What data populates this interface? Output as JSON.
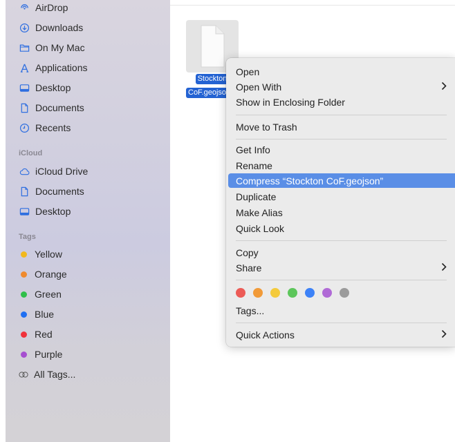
{
  "sidebar": {
    "favorites": [
      {
        "label": "AirDrop",
        "icon": "airdrop-icon"
      },
      {
        "label": "Downloads",
        "icon": "downloads-icon"
      },
      {
        "label": "On My Mac",
        "icon": "folder-icon"
      },
      {
        "label": "Applications",
        "icon": "applications-icon"
      },
      {
        "label": "Desktop",
        "icon": "desktop-icon"
      },
      {
        "label": "Documents",
        "icon": "document-icon"
      },
      {
        "label": "Recents",
        "icon": "clock-icon"
      }
    ],
    "icloud_header": "iCloud",
    "icloud": [
      {
        "label": "iCloud Drive",
        "icon": "cloud-icon"
      },
      {
        "label": "Documents",
        "icon": "document-icon"
      },
      {
        "label": "Desktop",
        "icon": "desktop-icon"
      }
    ],
    "tags_header": "Tags",
    "tags": [
      {
        "label": "Yellow",
        "color": "#f2b81d"
      },
      {
        "label": "Orange",
        "color": "#ef8a2e"
      },
      {
        "label": "Green",
        "color": "#2fbf4a"
      },
      {
        "label": "Blue",
        "color": "#1f6ff2"
      },
      {
        "label": "Red",
        "color": "#f0323a"
      },
      {
        "label": "Purple",
        "color": "#a64fd0"
      }
    ],
    "all_tags": "All Tags...",
    "accent_color": "#2f6fe0"
  },
  "file": {
    "name_line1": "Stockton",
    "name_line2": "CoF.geojson"
  },
  "context_menu": {
    "open": "Open",
    "open_with": "Open With",
    "show_enclosing": "Show in Enclosing Folder",
    "move_to_trash": "Move to Trash",
    "get_info": "Get Info",
    "rename": "Rename",
    "compress": "Compress “Stockton CoF.geojson”",
    "duplicate": "Duplicate",
    "make_alias": "Make Alias",
    "quick_look": "Quick Look",
    "copy": "Copy",
    "share": "Share",
    "tags": "Tags...",
    "quick_actions": "Quick Actions",
    "tag_colors": [
      "#ec5b56",
      "#f19a38",
      "#f4ca3c",
      "#5dc65b",
      "#3d82f7",
      "#b06ad6",
      "#9b9b9b"
    ],
    "highlight_color": "#5a8ee6"
  }
}
